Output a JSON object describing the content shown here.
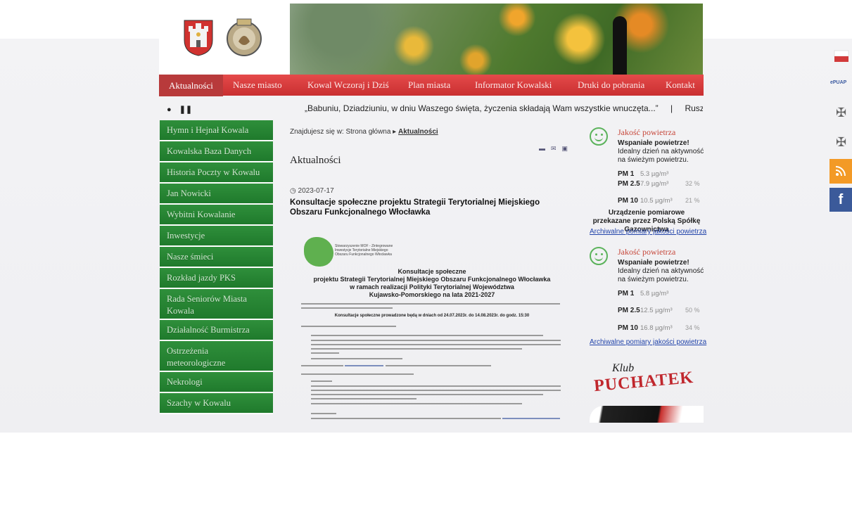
{
  "nav": {
    "items": [
      "Aktualności",
      "Nasze miasto",
      "Kowal Wczoraj i Dziś",
      "Plan miasta",
      "Informator Kowalski",
      "Druki do pobrania",
      "Kontakt"
    ]
  },
  "ticker": {
    "items": [
      "„Babuniu, Dziadziuniu, w dniu Waszego święta, życzenia składają Wam wszystkie wnuczęta...”",
      "|",
      "Ruszyła przebudowa"
    ]
  },
  "sidebar": {
    "items": [
      "Hymn i Hejnał Kowala",
      "Kowalska Baza Danych",
      "Historia Poczty w Kowalu",
      "Jan Nowicki",
      "Wybitni Kowalanie",
      "Inwestycje",
      "Nasze śmieci",
      "Rozkład jazdy PKS",
      "Rada Seniorów Miasta Kowala",
      "Działalność Burmistrza",
      "Ostrzeżenia meteorologiczne",
      "Nekrologi",
      "Szachy w Kowalu"
    ]
  },
  "breadcrumb": {
    "prefix": "Znajdujesz się w: Strona główna ▸",
    "current": "Aktualności"
  },
  "main": {
    "title": "Aktualności",
    "date": "2023-07-17",
    "article_title": "Konsultacje społeczne projektu Strategii Terytorialnej Miejskiego Obszaru Funkcjonalnego Włocławka",
    "doc": {
      "org": "Stowarzyszenie MOF - Zintegrowane Inwestycje Terytorialne Miejskiego Obszaru Funkcjonalnego Włocławka",
      "heading1": "Konsultacje społeczne",
      "heading2": "projektu Strategii Terytorialnej Miejskiego Obszaru Funkcjonalnego Włocławka",
      "heading3": "w ramach realizacji Polityki Terytorialnej Województwa",
      "heading4": "Kujawsko-Pomorskiego na lata 2021-2027",
      "dates": "Konsultacje społeczne prowadzone będą w dniach od 24.07.2023r. do 14.08.2023r. do godz. 15:30"
    }
  },
  "air": [
    {
      "title": "Jakość powietrza",
      "status": "Wspaniałe powietrze!",
      "desc": "Idealny dzień na aktywność na świeżym powietrzu.",
      "rows": [
        {
          "label": "PM 1",
          "value": "5.3 µg/m³",
          "pct": ""
        },
        {
          "label": "PM 2.5",
          "value": "7.9 µg/m³",
          "pct": "32 %"
        },
        {
          "label": "PM 10",
          "value": "10.5 µg/m³",
          "pct": "21 %"
        }
      ],
      "device": "Urządzenie pomiarowe przekazane przez Polską Spółkę Gazownictwa",
      "archive": "Archiwalne pomiary jakości powietrza"
    },
    {
      "title": "Jakość powietrza",
      "status": "Wspaniałe powietrze!",
      "desc": "Idealny dzień na aktywność na świeżym powietrzu.",
      "rows": [
        {
          "label": "PM 1",
          "value": "5.8 µg/m³",
          "pct": ""
        },
        {
          "label": "PM 2.5",
          "value": "12.5 µg/m³",
          "pct": "50 %"
        },
        {
          "label": "PM 10",
          "value": "16.8 µg/m³",
          "pct": "34 %"
        }
      ],
      "archive": "Archiwalne pomiary jakości powietrza"
    }
  ],
  "klub": {
    "line1": "Klub",
    "line2": "PUCHATEK"
  },
  "social": {
    "rss": "RSS",
    "fb": "f"
  },
  "colors": {
    "nav": "#d63b3c",
    "sidebar": "#2a8a36",
    "accent": "#c6473a",
    "link": "#2244aa"
  }
}
